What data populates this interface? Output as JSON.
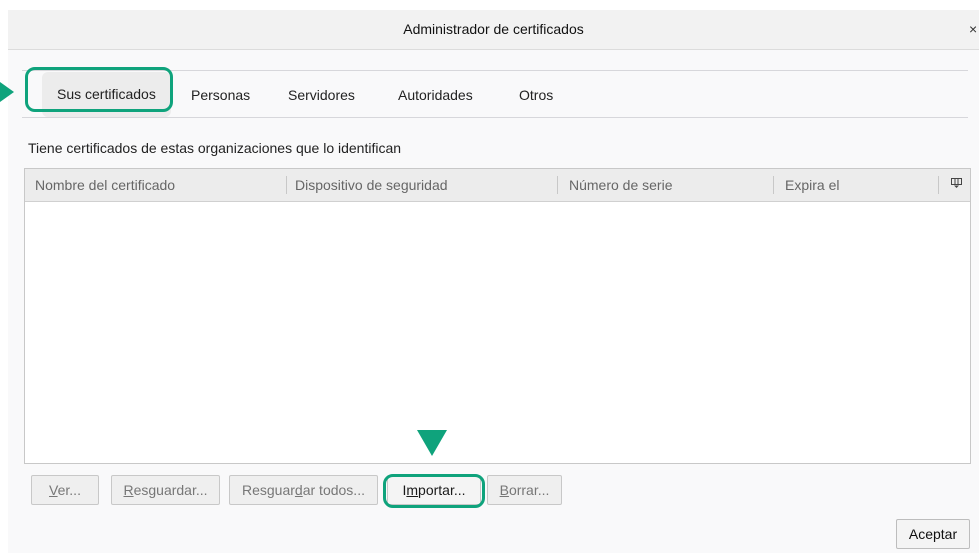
{
  "window": {
    "title": "Administrador de certificados",
    "close_glyph": "×"
  },
  "tabs": [
    {
      "label": "Sus certificados",
      "active": true
    },
    {
      "label": "Personas",
      "active": false
    },
    {
      "label": "Servidores",
      "active": false
    },
    {
      "label": "Autoridades",
      "active": false
    },
    {
      "label": "Otros",
      "active": false
    }
  ],
  "description": "Tiene certificados de estas organizaciones que lo identifican",
  "table": {
    "columns": [
      "Nombre del certificado",
      "Dispositivo de seguridad",
      "Número de serie",
      "Expira el"
    ],
    "column_picker_icon": "column-picker-icon",
    "rows": []
  },
  "buttons": {
    "ver": {
      "pre": "",
      "accel": "V",
      "post": "er..."
    },
    "resguardar": {
      "pre": "",
      "accel": "R",
      "post": "esguardar..."
    },
    "resguardar_todos": {
      "pre": "Resguar",
      "accel": "d",
      "post": "ar todos..."
    },
    "importar": {
      "pre": "I",
      "accel": "m",
      "post": "portar..."
    },
    "borrar": {
      "pre": "",
      "accel": "B",
      "post": "orrar..."
    },
    "aceptar": "Aceptar"
  },
  "colors": {
    "highlight": "#0fa37c"
  }
}
